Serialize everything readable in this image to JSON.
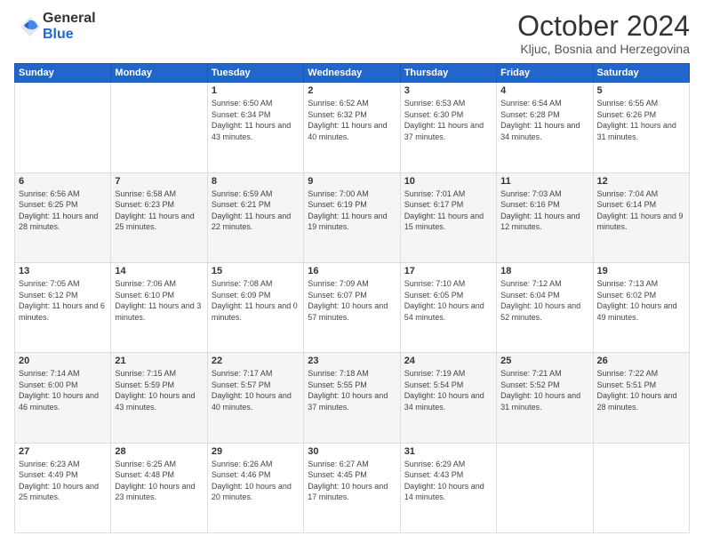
{
  "logo": {
    "general": "General",
    "blue": "Blue"
  },
  "header": {
    "title": "October 2024",
    "subtitle": "Kljuc, Bosnia and Herzegovina"
  },
  "calendar": {
    "weekdays": [
      "Sunday",
      "Monday",
      "Tuesday",
      "Wednesday",
      "Thursday",
      "Friday",
      "Saturday"
    ],
    "rows": [
      [
        {
          "day": "",
          "info": ""
        },
        {
          "day": "",
          "info": ""
        },
        {
          "day": "1",
          "info": "Sunrise: 6:50 AM\nSunset: 6:34 PM\nDaylight: 11 hours and 43 minutes."
        },
        {
          "day": "2",
          "info": "Sunrise: 6:52 AM\nSunset: 6:32 PM\nDaylight: 11 hours and 40 minutes."
        },
        {
          "day": "3",
          "info": "Sunrise: 6:53 AM\nSunset: 6:30 PM\nDaylight: 11 hours and 37 minutes."
        },
        {
          "day": "4",
          "info": "Sunrise: 6:54 AM\nSunset: 6:28 PM\nDaylight: 11 hours and 34 minutes."
        },
        {
          "day": "5",
          "info": "Sunrise: 6:55 AM\nSunset: 6:26 PM\nDaylight: 11 hours and 31 minutes."
        }
      ],
      [
        {
          "day": "6",
          "info": "Sunrise: 6:56 AM\nSunset: 6:25 PM\nDaylight: 11 hours and 28 minutes."
        },
        {
          "day": "7",
          "info": "Sunrise: 6:58 AM\nSunset: 6:23 PM\nDaylight: 11 hours and 25 minutes."
        },
        {
          "day": "8",
          "info": "Sunrise: 6:59 AM\nSunset: 6:21 PM\nDaylight: 11 hours and 22 minutes."
        },
        {
          "day": "9",
          "info": "Sunrise: 7:00 AM\nSunset: 6:19 PM\nDaylight: 11 hours and 19 minutes."
        },
        {
          "day": "10",
          "info": "Sunrise: 7:01 AM\nSunset: 6:17 PM\nDaylight: 11 hours and 15 minutes."
        },
        {
          "day": "11",
          "info": "Sunrise: 7:03 AM\nSunset: 6:16 PM\nDaylight: 11 hours and 12 minutes."
        },
        {
          "day": "12",
          "info": "Sunrise: 7:04 AM\nSunset: 6:14 PM\nDaylight: 11 hours and 9 minutes."
        }
      ],
      [
        {
          "day": "13",
          "info": "Sunrise: 7:05 AM\nSunset: 6:12 PM\nDaylight: 11 hours and 6 minutes."
        },
        {
          "day": "14",
          "info": "Sunrise: 7:06 AM\nSunset: 6:10 PM\nDaylight: 11 hours and 3 minutes."
        },
        {
          "day": "15",
          "info": "Sunrise: 7:08 AM\nSunset: 6:09 PM\nDaylight: 11 hours and 0 minutes."
        },
        {
          "day": "16",
          "info": "Sunrise: 7:09 AM\nSunset: 6:07 PM\nDaylight: 10 hours and 57 minutes."
        },
        {
          "day": "17",
          "info": "Sunrise: 7:10 AM\nSunset: 6:05 PM\nDaylight: 10 hours and 54 minutes."
        },
        {
          "day": "18",
          "info": "Sunrise: 7:12 AM\nSunset: 6:04 PM\nDaylight: 10 hours and 52 minutes."
        },
        {
          "day": "19",
          "info": "Sunrise: 7:13 AM\nSunset: 6:02 PM\nDaylight: 10 hours and 49 minutes."
        }
      ],
      [
        {
          "day": "20",
          "info": "Sunrise: 7:14 AM\nSunset: 6:00 PM\nDaylight: 10 hours and 46 minutes."
        },
        {
          "day": "21",
          "info": "Sunrise: 7:15 AM\nSunset: 5:59 PM\nDaylight: 10 hours and 43 minutes."
        },
        {
          "day": "22",
          "info": "Sunrise: 7:17 AM\nSunset: 5:57 PM\nDaylight: 10 hours and 40 minutes."
        },
        {
          "day": "23",
          "info": "Sunrise: 7:18 AM\nSunset: 5:55 PM\nDaylight: 10 hours and 37 minutes."
        },
        {
          "day": "24",
          "info": "Sunrise: 7:19 AM\nSunset: 5:54 PM\nDaylight: 10 hours and 34 minutes."
        },
        {
          "day": "25",
          "info": "Sunrise: 7:21 AM\nSunset: 5:52 PM\nDaylight: 10 hours and 31 minutes."
        },
        {
          "day": "26",
          "info": "Sunrise: 7:22 AM\nSunset: 5:51 PM\nDaylight: 10 hours and 28 minutes."
        }
      ],
      [
        {
          "day": "27",
          "info": "Sunrise: 6:23 AM\nSunset: 4:49 PM\nDaylight: 10 hours and 25 minutes."
        },
        {
          "day": "28",
          "info": "Sunrise: 6:25 AM\nSunset: 4:48 PM\nDaylight: 10 hours and 23 minutes."
        },
        {
          "day": "29",
          "info": "Sunrise: 6:26 AM\nSunset: 4:46 PM\nDaylight: 10 hours and 20 minutes."
        },
        {
          "day": "30",
          "info": "Sunrise: 6:27 AM\nSunset: 4:45 PM\nDaylight: 10 hours and 17 minutes."
        },
        {
          "day": "31",
          "info": "Sunrise: 6:29 AM\nSunset: 4:43 PM\nDaylight: 10 hours and 14 minutes."
        },
        {
          "day": "",
          "info": ""
        },
        {
          "day": "",
          "info": ""
        }
      ]
    ]
  }
}
